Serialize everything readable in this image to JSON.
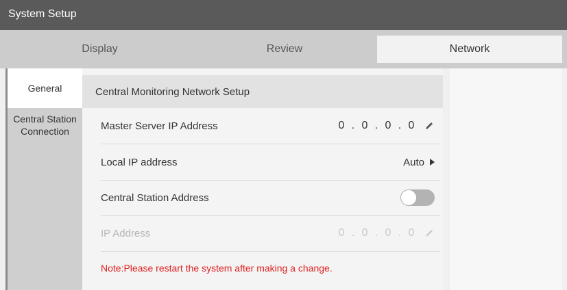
{
  "window": {
    "title": "System Setup"
  },
  "tabs": [
    {
      "label": "Display"
    },
    {
      "label": "Review"
    },
    {
      "label": "Network"
    }
  ],
  "sidebar": {
    "items": [
      {
        "label": "General"
      },
      {
        "label": "Central Station Connection"
      }
    ]
  },
  "section": {
    "title": "Central Monitoring Network Setup"
  },
  "rows": {
    "master_server": {
      "label": "Master Server IP Address",
      "octets": [
        "0",
        "0",
        "0",
        "0"
      ]
    },
    "local_ip": {
      "label": "Local IP address",
      "value": "Auto"
    },
    "central_station_address": {
      "label": "Central Station Address",
      "enabled": false
    },
    "ip_address": {
      "label": "IP Address",
      "octets": [
        "0",
        "0",
        "0",
        "0"
      ]
    }
  },
  "note": "Note:Please restart the system after making a change.",
  "colors": {
    "note": "#e02020",
    "titlebar": "#5a5a5a"
  },
  "icons": {
    "edit": "pencil-icon",
    "expand": "triangle-right-icon"
  }
}
